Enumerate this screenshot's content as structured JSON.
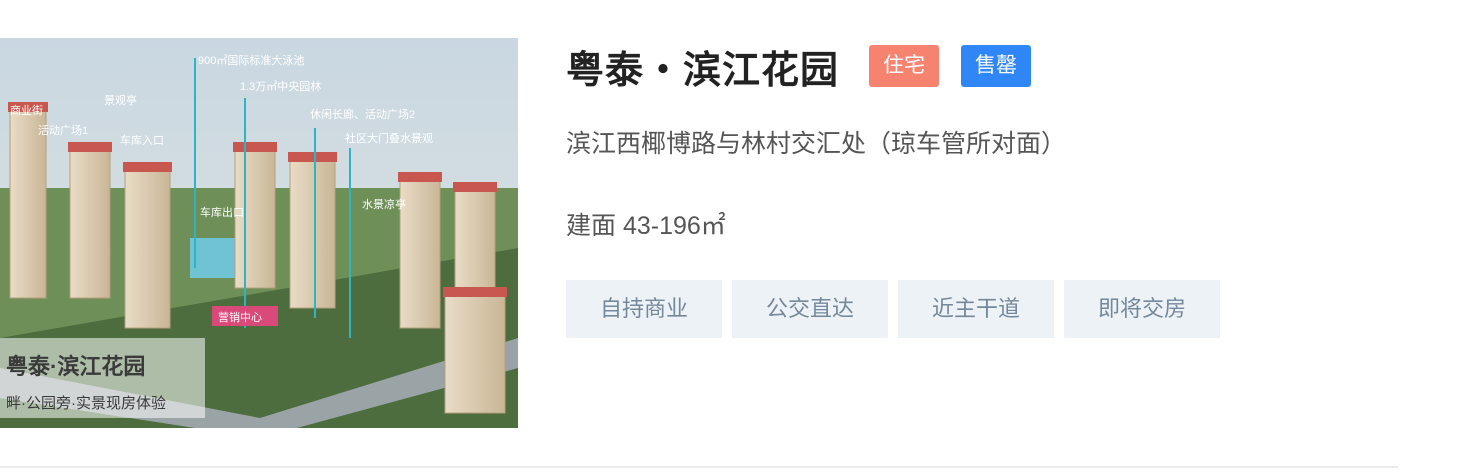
{
  "listing": {
    "image": {
      "caption_title": "粤泰·滨江花园",
      "caption_sub": "畔·公园旁·实景现房体验",
      "labels": [
        "900㎡国际标准大泳池",
        "1.3万㎡中央园林",
        "休闲长廊、活动广场2",
        "社区大门叠水景观",
        "商业街",
        "活动广场1",
        "景观亭",
        "车库入口",
        "车库出口",
        "水景凉亭",
        "营销中心"
      ]
    },
    "title": "粤泰・滨江花园",
    "type_badge": "住宅",
    "status_badge": "售罄",
    "address": "滨江西椰博路与林村交汇处（琼车管所对面）",
    "area": "建面 43-196㎡",
    "tags": [
      "自持商业",
      "公交直达",
      "近主干道",
      "即将交房"
    ],
    "colors": {
      "type_badge": "#f6836f",
      "status_badge": "#2f86f6",
      "tag_bg": "#edf2f6",
      "tag_text": "#74889b"
    }
  }
}
